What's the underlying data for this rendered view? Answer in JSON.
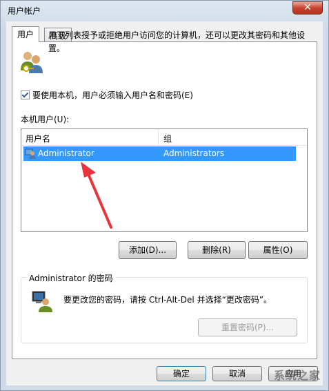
{
  "window": {
    "title": "用户帐户",
    "close_symbol": "✕"
  },
  "tabs": [
    {
      "label": "用户"
    },
    {
      "label": "高级"
    }
  ],
  "description": "用下列表授予或拒绝用户访问您的计算机，还可以更改其密码和其他设置。",
  "checkbox": {
    "label": "要使用本机，用户必须输入用户名和密码(E)",
    "checked": true
  },
  "users_section": {
    "label": "本机用户(U):",
    "columns": [
      "用户名",
      "组"
    ],
    "rows": [
      {
        "username": "Administrator",
        "group": "Administrators",
        "selected": true
      }
    ]
  },
  "buttons": {
    "add": "添加(D)...",
    "delete": "删除(R)",
    "properties": "属性(O)"
  },
  "password_section": {
    "title": "Administrator 的密码",
    "text": "要更改您的密码，请按 Ctrl-Alt-Del 并选择“更改密码”。",
    "reset_button": "重置密码(P)..."
  },
  "footer": {
    "ok": "确定",
    "cancel": "取消",
    "apply": "应用"
  },
  "watermark": "系统之家",
  "colors": {
    "selection": "#3399ff",
    "arrow": "#e8343a"
  },
  "icons": [
    "users-icon",
    "user-icon",
    "monitor-user-icon",
    "red-arrow"
  ]
}
